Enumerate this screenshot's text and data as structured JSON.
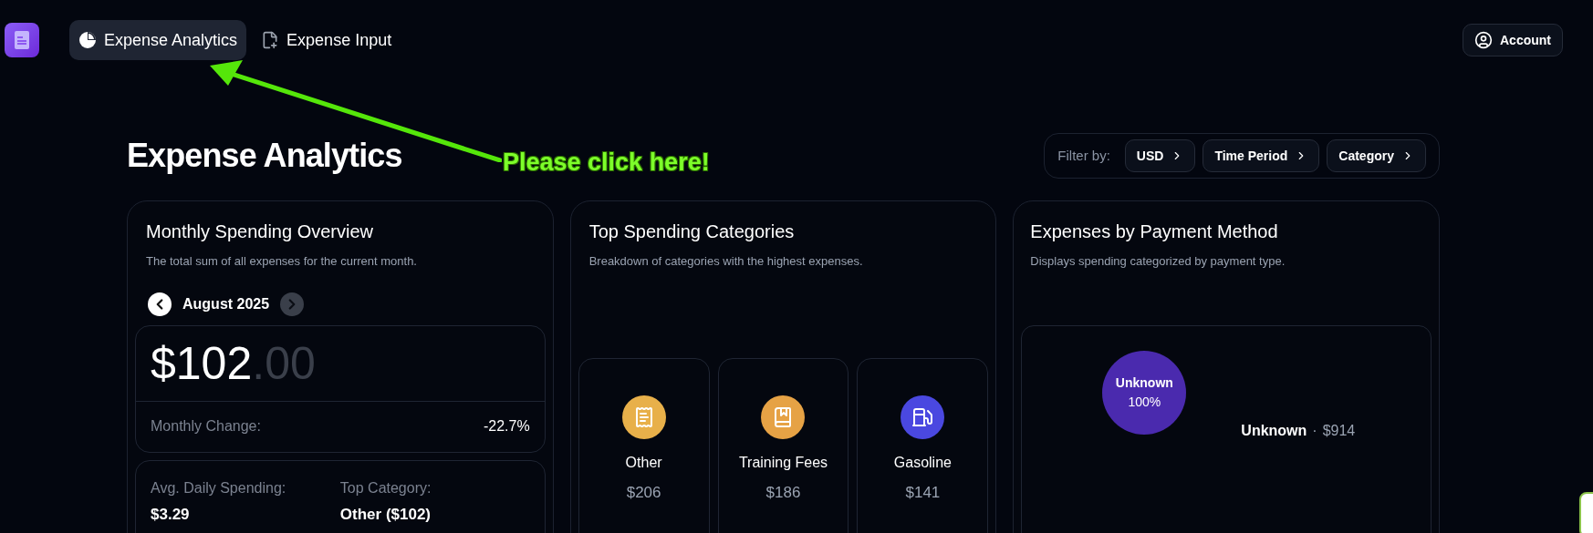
{
  "nav": {
    "tabs": [
      {
        "label": "Expense Analytics",
        "kind": "chart",
        "selected": true
      },
      {
        "label": "Expense Input",
        "kind": "file",
        "selected": false
      }
    ],
    "account": "Account"
  },
  "annotation": {
    "text": "Please click here!"
  },
  "page": {
    "title": "Expense Analytics",
    "filter": {
      "label": "Filter by:",
      "chips": [
        "USD",
        "Time Period",
        "Category"
      ]
    }
  },
  "overview": {
    "title": "Monthly Spending Overview",
    "description": "The total sum of all expenses for the current month.",
    "month": "August 2025",
    "prev": {
      "disabled": false
    },
    "next": {
      "disabled": true
    },
    "amount_whole": "$102",
    "amount_cents": ".00",
    "change_label": "Monthly Change:",
    "change_value": "-22.7%",
    "stats": [
      {
        "label": "Avg. Daily Spending:",
        "value": "$3.29"
      },
      {
        "label": "Top Category:",
        "value": "Other ($102)"
      }
    ]
  },
  "categories": {
    "title": "Top Spending Categories",
    "description": "Breakdown of categories with the highest expenses.",
    "items": [
      {
        "name": "Other",
        "amount": "$206",
        "kind": "receipt",
        "color": "#e8b04a"
      },
      {
        "name": "Training Fees",
        "amount": "$186",
        "kind": "book",
        "color": "#e6a245"
      },
      {
        "name": "Gasoline",
        "amount": "$141",
        "kind": "fuel",
        "color": "#4a48e0"
      }
    ]
  },
  "payment": {
    "title": "Expenses by Payment Method",
    "description": "Displays spending categorized by payment type.",
    "slices": [
      {
        "label": "Unknown",
        "share": "100%",
        "color": "#4a2aae"
      }
    ],
    "legend": [
      {
        "label": "Unknown",
        "separator": "·",
        "amount": "$914"
      }
    ]
  }
}
